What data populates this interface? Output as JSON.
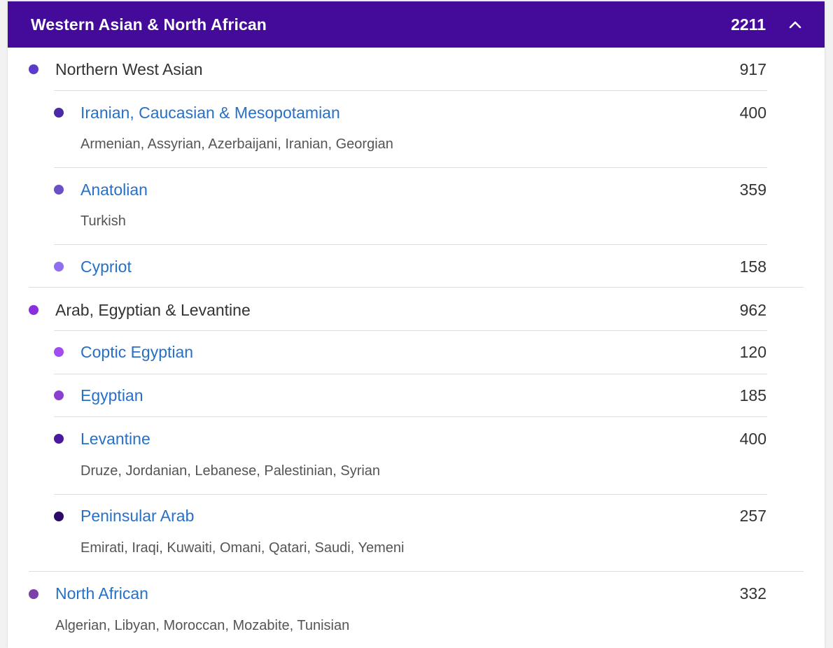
{
  "region": {
    "title": "Western Asian & North African",
    "count": "2211",
    "toggle_icon": "chevron-up-icon",
    "header_color": "#440a9a"
  },
  "groups": [
    {
      "name": "Northern West Asian",
      "count": "917",
      "color": "#5b3bc9",
      "linked": false,
      "children": [
        {
          "name": "Iranian, Caucasian & Mesopotamian",
          "count": "400",
          "color": "#4a2aa6",
          "sub": "Armenian, Assyrian, Azerbaijani, Iranian, Georgian"
        },
        {
          "name": "Anatolian",
          "count": "359",
          "color": "#6b4fc7",
          "sub": "Turkish"
        },
        {
          "name": "Cypriot",
          "count": "158",
          "color": "#8f6ef0",
          "sub": ""
        }
      ]
    },
    {
      "name": "Arab, Egyptian & Levantine",
      "count": "962",
      "color": "#8a2fe0",
      "linked": false,
      "children": [
        {
          "name": "Coptic Egyptian",
          "count": "120",
          "color": "#a24cf0",
          "sub": ""
        },
        {
          "name": "Egyptian",
          "count": "185",
          "color": "#8a3fd0",
          "sub": ""
        },
        {
          "name": "Levantine",
          "count": "400",
          "color": "#4a1a9e",
          "sub": "Druze, Jordanian, Lebanese, Palestinian, Syrian"
        },
        {
          "name": "Peninsular Arab",
          "count": "257",
          "color": "#2b0a6a",
          "sub": "Emirati, Iraqi, Kuwaiti, Omani, Qatari, Saudi, Yemeni"
        }
      ]
    },
    {
      "name": "North African",
      "count": "332",
      "color": "#7d3fa8",
      "linked": true,
      "sub": "Algerian, Libyan, Moroccan, Mozabite, Tunisian",
      "children": []
    }
  ]
}
